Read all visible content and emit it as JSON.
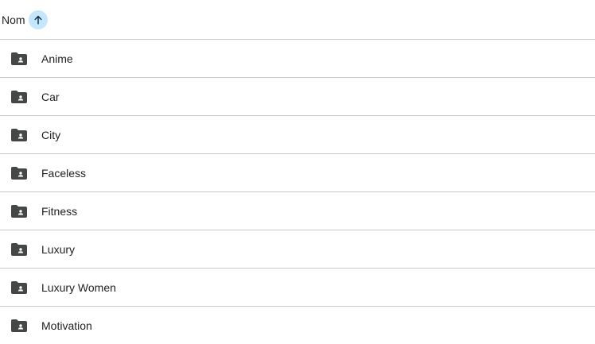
{
  "header": {
    "column_label": "Nom",
    "sort_icon": "arrow-up-icon",
    "sort_direction": "ascending"
  },
  "folder_icon": "shared-folder-icon",
  "colors": {
    "icon": "#444746",
    "sort_badge_bg": "#c2e7ff",
    "sort_arrow": "#001d35",
    "divider": "#c7c7c7"
  },
  "folders": [
    {
      "label": "Anime"
    },
    {
      "label": "Car"
    },
    {
      "label": "City"
    },
    {
      "label": "Faceless"
    },
    {
      "label": "Fitness"
    },
    {
      "label": "Luxury"
    },
    {
      "label": "Luxury Women"
    },
    {
      "label": "Motivation"
    }
  ]
}
